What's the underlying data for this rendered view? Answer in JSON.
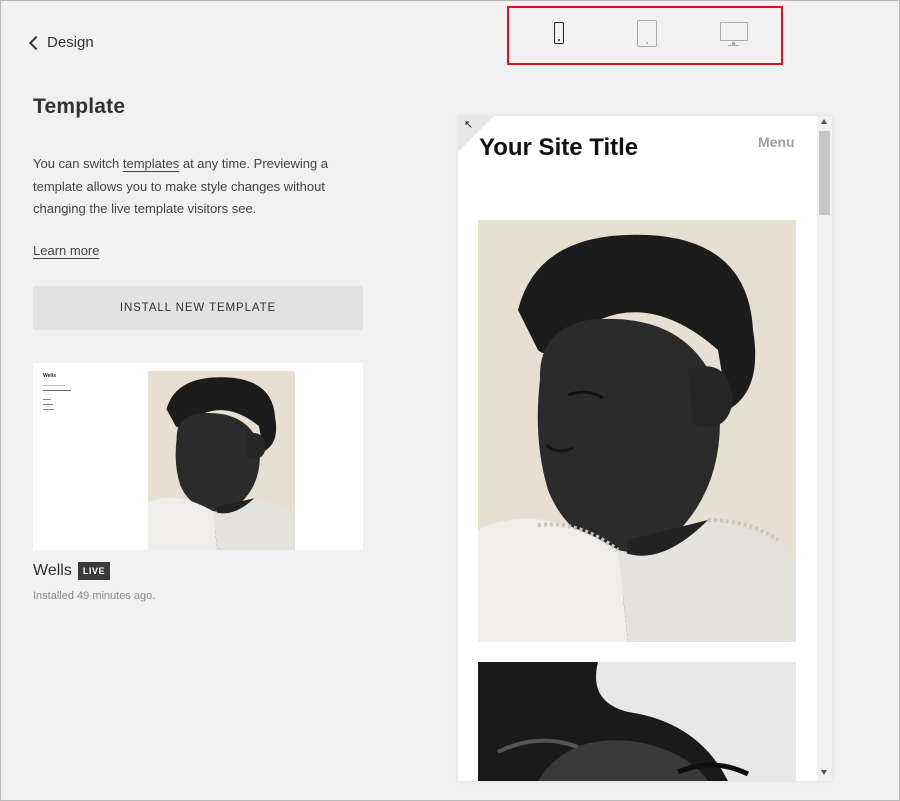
{
  "nav": {
    "back_label": "Design"
  },
  "panel": {
    "title": "Template",
    "description": {
      "before": "You can switch ",
      "link": "templates",
      "after": " at any time. Previewing a template allows you to make style changes without changing the live template visitors see."
    },
    "learn_more": "Learn more",
    "install_button": "INSTALL NEW TEMPLATE",
    "current_template": {
      "name": "Wells",
      "badge": "LIVE",
      "installed": "Installed 49 minutes ago."
    }
  },
  "device_toggle": {
    "options": [
      "phone-icon",
      "tablet-icon",
      "desktop-icon"
    ],
    "selected": "phone-icon"
  },
  "preview": {
    "site_title": "Your Site Title",
    "menu": "Menu"
  },
  "colors": {
    "highlight": "#d9151b",
    "live_badge": "#3a3a3a"
  }
}
